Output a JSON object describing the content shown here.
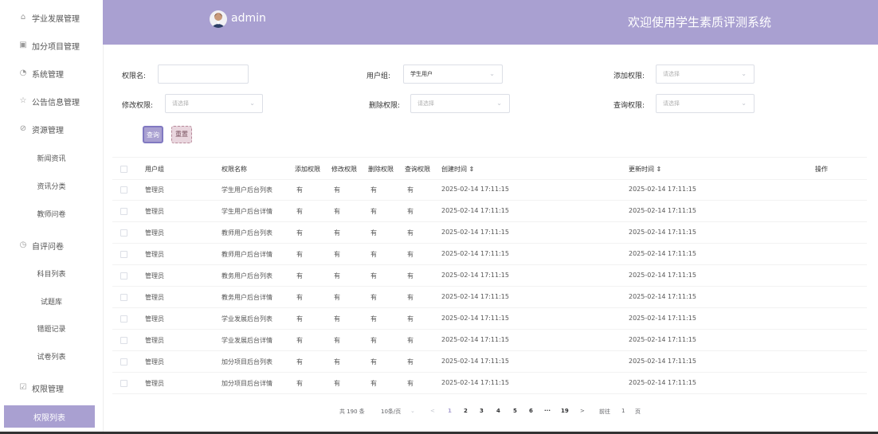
{
  "sidebar": {
    "items": [
      {
        "label": "学业发展管理",
        "icon": "home-icon"
      },
      {
        "label": "加分项目管理",
        "icon": "gift-icon"
      },
      {
        "label": "系统管理",
        "icon": "gear-icon"
      },
      {
        "label": "公告信息管理",
        "icon": "star-icon"
      },
      {
        "label": "资源管理",
        "icon": "compass-icon"
      },
      {
        "label": "新闻资讯"
      },
      {
        "label": "资讯分类"
      },
      {
        "label": "教师问卷"
      },
      {
        "label": "自评问卷",
        "icon": "clock-icon"
      },
      {
        "label": "科目列表"
      },
      {
        "label": "试题库"
      },
      {
        "label": "错题记录"
      },
      {
        "label": "试卷列表"
      },
      {
        "label": "权限管理",
        "icon": "checkbox-icon"
      },
      {
        "label": "权限列表"
      }
    ]
  },
  "header": {
    "username": "admin",
    "welcome": "欢迎使用学生素质评测系统",
    "bg_color": "#a9a0d1"
  },
  "filters": {
    "perm_name_label": "权限名:",
    "perm_name_value": "",
    "user_group_label": "用户组:",
    "user_group_value": "学生用户",
    "add_perm_label": "添加权限:",
    "modify_perm_label": "修改权限:",
    "delete_perm_label": "删除权限:",
    "query_perm_label": "查询权限:",
    "select_placeholder": "请选择",
    "search_button": "查询",
    "reset_button": "重置"
  },
  "table": {
    "headers": {
      "group": "用户组",
      "name": "权限名称",
      "add": "添加权限",
      "modify": "修改权限",
      "delete": "删除权限",
      "query": "查询权限",
      "created": "创建时间 ⇕",
      "updated": "更新时间 ⇕",
      "action": "操作"
    },
    "rows": [
      {
        "group": "管理员",
        "name": "学生用户后台列表",
        "add": "有",
        "modify": "有",
        "delete": "有",
        "query": "有",
        "created": "2025-02-14 17:11:15",
        "updated": "2025-02-14 17:11:15"
      },
      {
        "group": "管理员",
        "name": "学生用户后台详情",
        "add": "有",
        "modify": "有",
        "delete": "有",
        "query": "有",
        "created": "2025-02-14 17:11:15",
        "updated": "2025-02-14 17:11:15"
      },
      {
        "group": "管理员",
        "name": "教师用户后台列表",
        "add": "有",
        "modify": "有",
        "delete": "有",
        "query": "有",
        "created": "2025-02-14 17:11:15",
        "updated": "2025-02-14 17:11:15"
      },
      {
        "group": "管理员",
        "name": "教师用户后台详情",
        "add": "有",
        "modify": "有",
        "delete": "有",
        "query": "有",
        "created": "2025-02-14 17:11:15",
        "updated": "2025-02-14 17:11:15"
      },
      {
        "group": "管理员",
        "name": "教务用户后台列表",
        "add": "有",
        "modify": "有",
        "delete": "有",
        "query": "有",
        "created": "2025-02-14 17:11:15",
        "updated": "2025-02-14 17:11:15"
      },
      {
        "group": "管理员",
        "name": "教务用户后台详情",
        "add": "有",
        "modify": "有",
        "delete": "有",
        "query": "有",
        "created": "2025-02-14 17:11:15",
        "updated": "2025-02-14 17:11:15"
      },
      {
        "group": "管理员",
        "name": "学业发展后台列表",
        "add": "有",
        "modify": "有",
        "delete": "有",
        "query": "有",
        "created": "2025-02-14 17:11:15",
        "updated": "2025-02-14 17:11:15"
      },
      {
        "group": "管理员",
        "name": "学业发展后台详情",
        "add": "有",
        "modify": "有",
        "delete": "有",
        "query": "有",
        "created": "2025-02-14 17:11:15",
        "updated": "2025-02-14 17:11:15"
      },
      {
        "group": "管理员",
        "name": "加分项目后台列表",
        "add": "有",
        "modify": "有",
        "delete": "有",
        "query": "有",
        "created": "2025-02-14 17:11:15",
        "updated": "2025-02-14 17:11:15"
      },
      {
        "group": "管理员",
        "name": "加分项目后台详情",
        "add": "有",
        "modify": "有",
        "delete": "有",
        "query": "有",
        "created": "2025-02-14 17:11:15",
        "updated": "2025-02-14 17:11:15"
      }
    ]
  },
  "pagination": {
    "total": "共 190 条",
    "page_size": "10条/页",
    "prev": "<",
    "pages": [
      "1",
      "2",
      "3",
      "4",
      "5",
      "6"
    ],
    "ellipsis": "···",
    "last": "19",
    "next": ">",
    "goto_label": "前往",
    "goto_value": "1",
    "goto_suffix": "页"
  }
}
